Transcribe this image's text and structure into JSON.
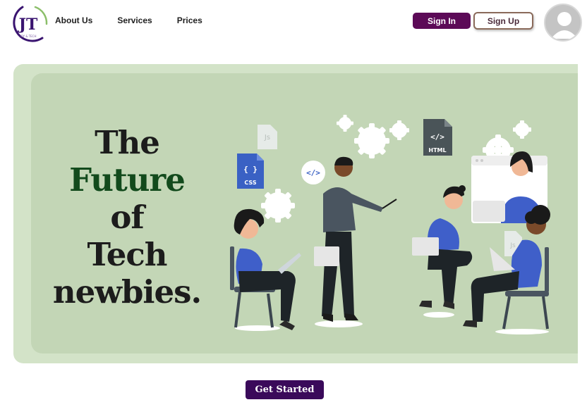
{
  "header": {
    "logo_text": "JT",
    "logo_tagline": "JOY & TECH",
    "nav": [
      {
        "label": "About Us"
      },
      {
        "label": "Services"
      },
      {
        "label": "Prices"
      }
    ],
    "sign_in_label": "Sign In",
    "sign_up_label": "Sign Up"
  },
  "hero": {
    "headline_line1": "The",
    "headline_accent": "Future",
    "headline_line2_rest": " of",
    "headline_line3": "Tech",
    "headline_line4": "newbies.",
    "file_labels": {
      "css": "CSS",
      "html": "HTML",
      "js": "Js",
      "code": "</>",
      "braces": "{ }"
    }
  },
  "cta": {
    "label": "Get Started"
  },
  "colors": {
    "sign_in_bg": "#5c0a57",
    "cta_bg": "#3a0a5a",
    "hero_outer": "#d3e3c8",
    "hero_inner": "#c3d6b6",
    "accent_text": "#124a1c",
    "figure_blue": "#3f5fc9"
  }
}
